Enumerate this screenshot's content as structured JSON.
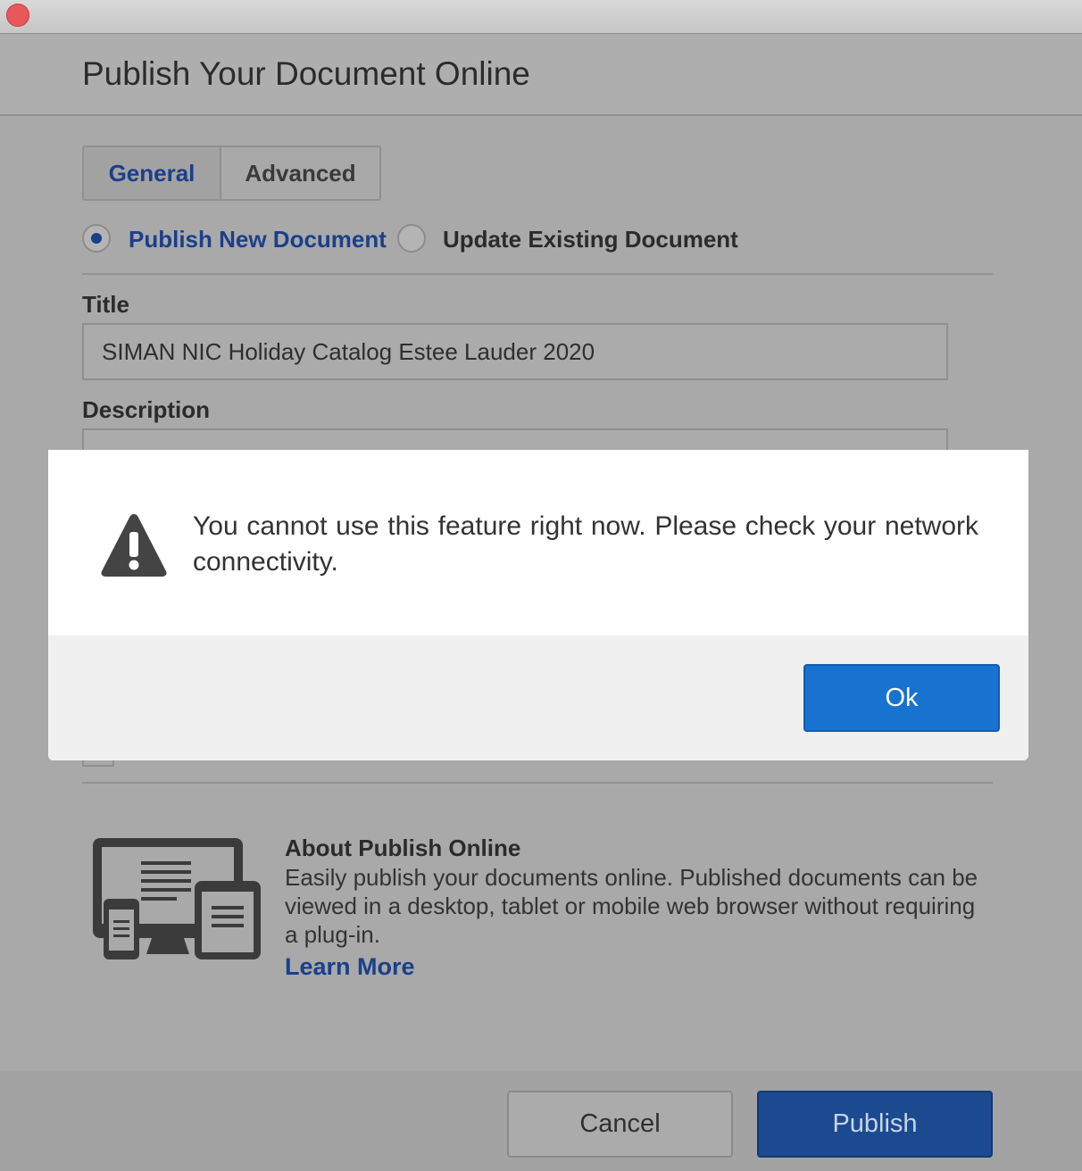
{
  "dialog": {
    "title": "Publish Your Document Online",
    "tabs": [
      {
        "label": "General",
        "selected": true
      },
      {
        "label": "Advanced",
        "selected": false
      }
    ],
    "radio_options": [
      {
        "label": "Publish New Document",
        "checked": true
      },
      {
        "label": "Update Existing Document",
        "checked": false
      }
    ],
    "title_field": {
      "label": "Title",
      "value": "SIMAN NIC Holiday Catalog Estee Lauder 2020"
    },
    "description_field": {
      "label": "Description"
    },
    "about": {
      "title": "About Publish Online",
      "text": "Easily publish your documents online. Published documents can be viewed in a desktop, tablet or mobile web browser without requiring a plug-in.",
      "learn_more": "Learn More",
      "icon": "devices-icon"
    },
    "buttons": {
      "cancel": "Cancel",
      "publish": "Publish"
    }
  },
  "alert": {
    "icon": "warning-icon",
    "message": "You cannot use this feature right now. Please check your network connectivity.",
    "ok_label": "Ok"
  },
  "colors": {
    "accent": "#1b3f8a",
    "ok_button": "#1772d0",
    "close_button": "#e8575a"
  }
}
